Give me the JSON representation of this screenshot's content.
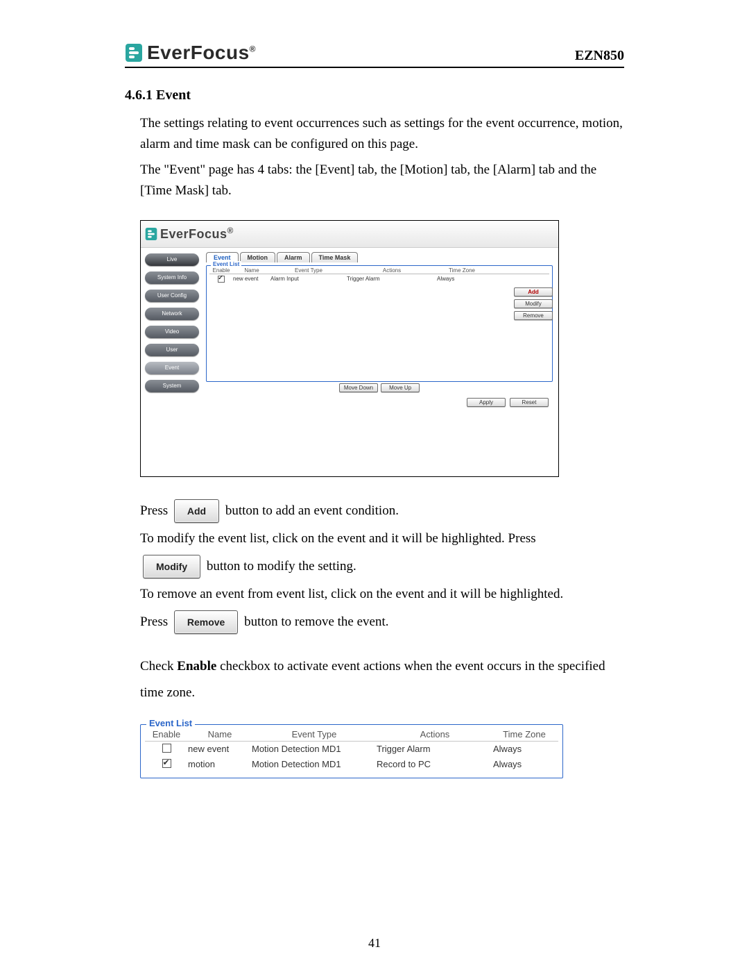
{
  "header": {
    "brand": "EverFocus",
    "reg": "®",
    "model": "EZN850"
  },
  "section": {
    "number_title": "4.6.1 Event"
  },
  "intro": {
    "p1": "The settings relating to event occurrences such as settings for the event occurrence, motion, alarm and time mask can be configured on this page.",
    "p2": "The \"Event\" page has 4 tabs: the [Event] tab, the [Motion] tab, the [Alarm] tab and the [Time Mask] tab."
  },
  "screenshot1": {
    "brand": "EverFocus",
    "sidenav": {
      "live": "Live",
      "system_info": "System Info",
      "user_config": "User Config",
      "network": "Network",
      "video": "Video",
      "user": "User",
      "event": "Event",
      "system": "System"
    },
    "tabs": {
      "event": "Event",
      "motion": "Motion",
      "alarm": "Alarm",
      "time_mask": "Time Mask"
    },
    "fieldset_title": "Event List",
    "columns": {
      "enable": "Enable",
      "name": "Name",
      "event_type": "Event Type",
      "actions": "Actions",
      "time_zone": "Time Zone"
    },
    "rows": [
      {
        "enabled": true,
        "name": "new event",
        "event_type": "Alarm Input",
        "actions": "Trigger Alarm",
        "time_zone": "Always"
      }
    ],
    "buttons": {
      "add": "Add",
      "modify": "Modify",
      "remove": "Remove",
      "move_down": "Move Down",
      "move_up": "Move Up",
      "apply": "Apply",
      "reset": "Reset"
    }
  },
  "instructions": {
    "press": "Press",
    "add_btn": "Add",
    "add_after": "button to add an event condition.",
    "modify_intro": "To modify the event list, click on the event and it will be highlighted. Press",
    "modify_btn": "Modify",
    "modify_after": "button to modify the setting.",
    "remove_intro": "To remove an event from event list, click on the event and it will be highlighted.",
    "remove_btn": "Remove",
    "remove_after": "button to remove the event.",
    "enable_pre": "Check ",
    "enable_bold": "Enable",
    "enable_post": " checkbox to activate event actions when the event occurs in the specified time zone."
  },
  "screenshot2": {
    "fieldset_title": "Event List",
    "columns": {
      "enable": "Enable",
      "name": "Name",
      "event_type": "Event Type",
      "actions": "Actions",
      "time_zone": "Time Zone"
    },
    "rows": [
      {
        "enabled": false,
        "name": "new event",
        "event_type": "Motion Detection MD1",
        "actions": "Trigger Alarm",
        "time_zone": "Always"
      },
      {
        "enabled": true,
        "name": "motion",
        "event_type": "Motion Detection MD1",
        "actions": "Record to PC",
        "time_zone": "Always"
      }
    ]
  },
  "page_number": "41"
}
